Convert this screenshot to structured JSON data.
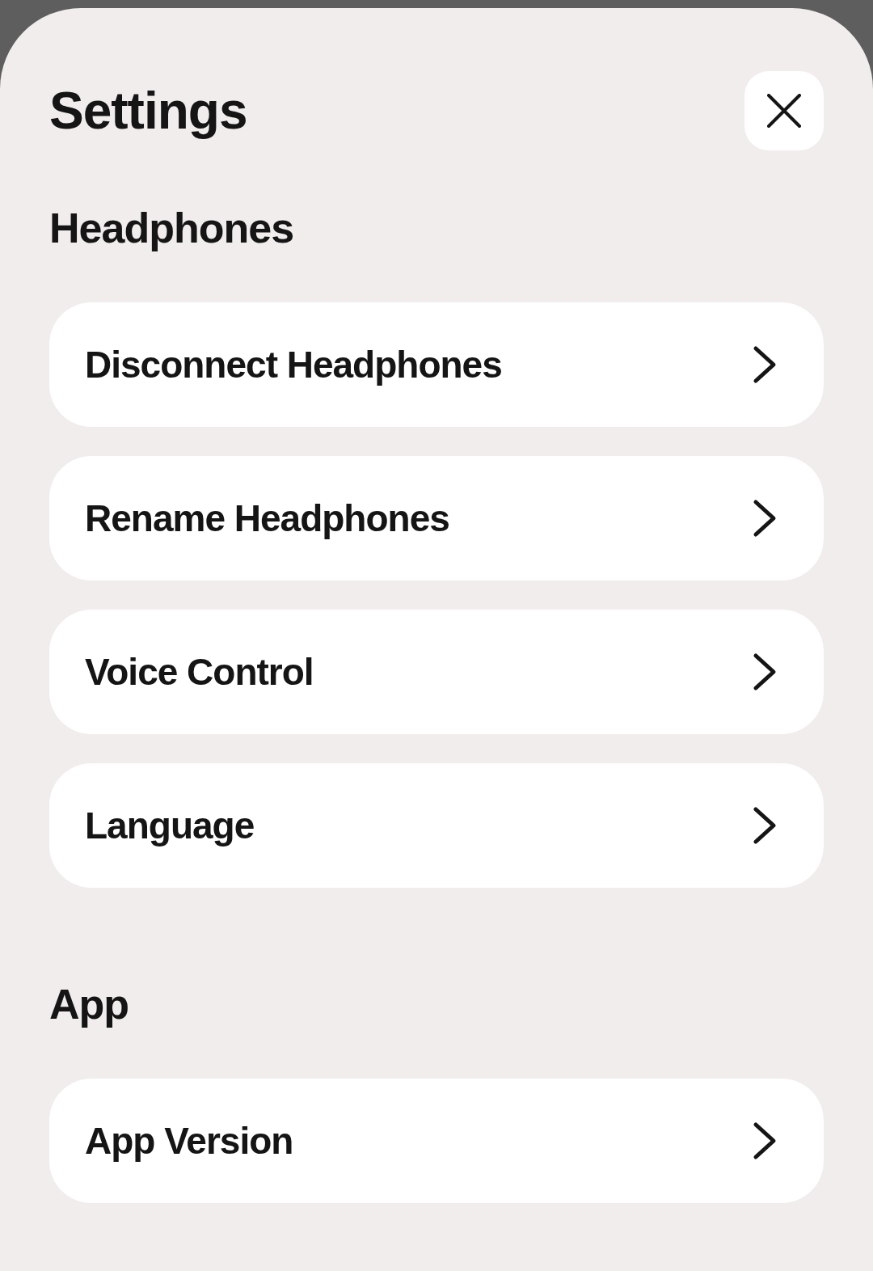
{
  "title": "Settings",
  "sections": [
    {
      "heading": "Headphones",
      "items": [
        {
          "label": "Disconnect Headphones"
        },
        {
          "label": "Rename Headphones"
        },
        {
          "label": "Voice Control"
        },
        {
          "label": "Language"
        }
      ]
    },
    {
      "heading": "App",
      "items": [
        {
          "label": "App Version"
        }
      ]
    }
  ]
}
